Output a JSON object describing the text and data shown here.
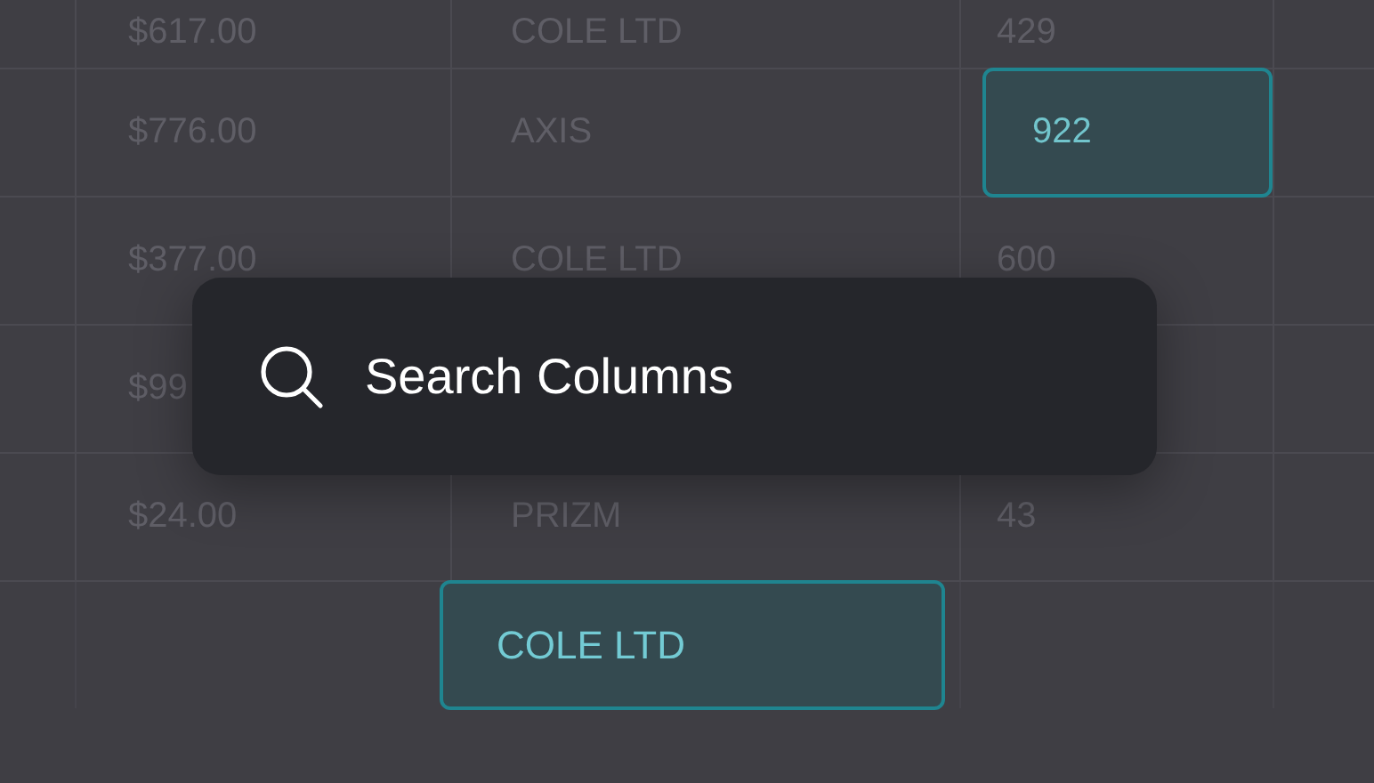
{
  "table": {
    "rows": [
      {
        "column_1": {
          "text": "$617.00",
          "selected": false
        },
        "column_2": {
          "text": "COLE LTD",
          "selected": false
        },
        "column_3": {
          "text": "429",
          "selected": false
        }
      },
      {
        "column_1": {
          "text": "$776.00",
          "selected": false
        },
        "column_2": {
          "text": "AXIS",
          "selected": false
        },
        "column_3": {
          "text": "922",
          "selected": true
        }
      },
      {
        "column_1": {
          "text": "$377.00",
          "selected": false
        },
        "column_2": {
          "text": "COLE LTD",
          "selected": false
        },
        "column_3": {
          "text": "600",
          "selected": false
        }
      },
      {
        "column_1": {
          "text": "$99",
          "selected": false
        }
      },
      {
        "column_1": {
          "text": "$24.00",
          "selected": false
        },
        "column_2": {
          "text": "PRIZM",
          "selected": false
        },
        "column_3": {
          "text": "43",
          "selected": false
        }
      },
      {
        "column_2": {
          "text": "COLE LTD",
          "selected": true
        }
      }
    ]
  },
  "search": {
    "placeholder": "Search Columns"
  }
}
